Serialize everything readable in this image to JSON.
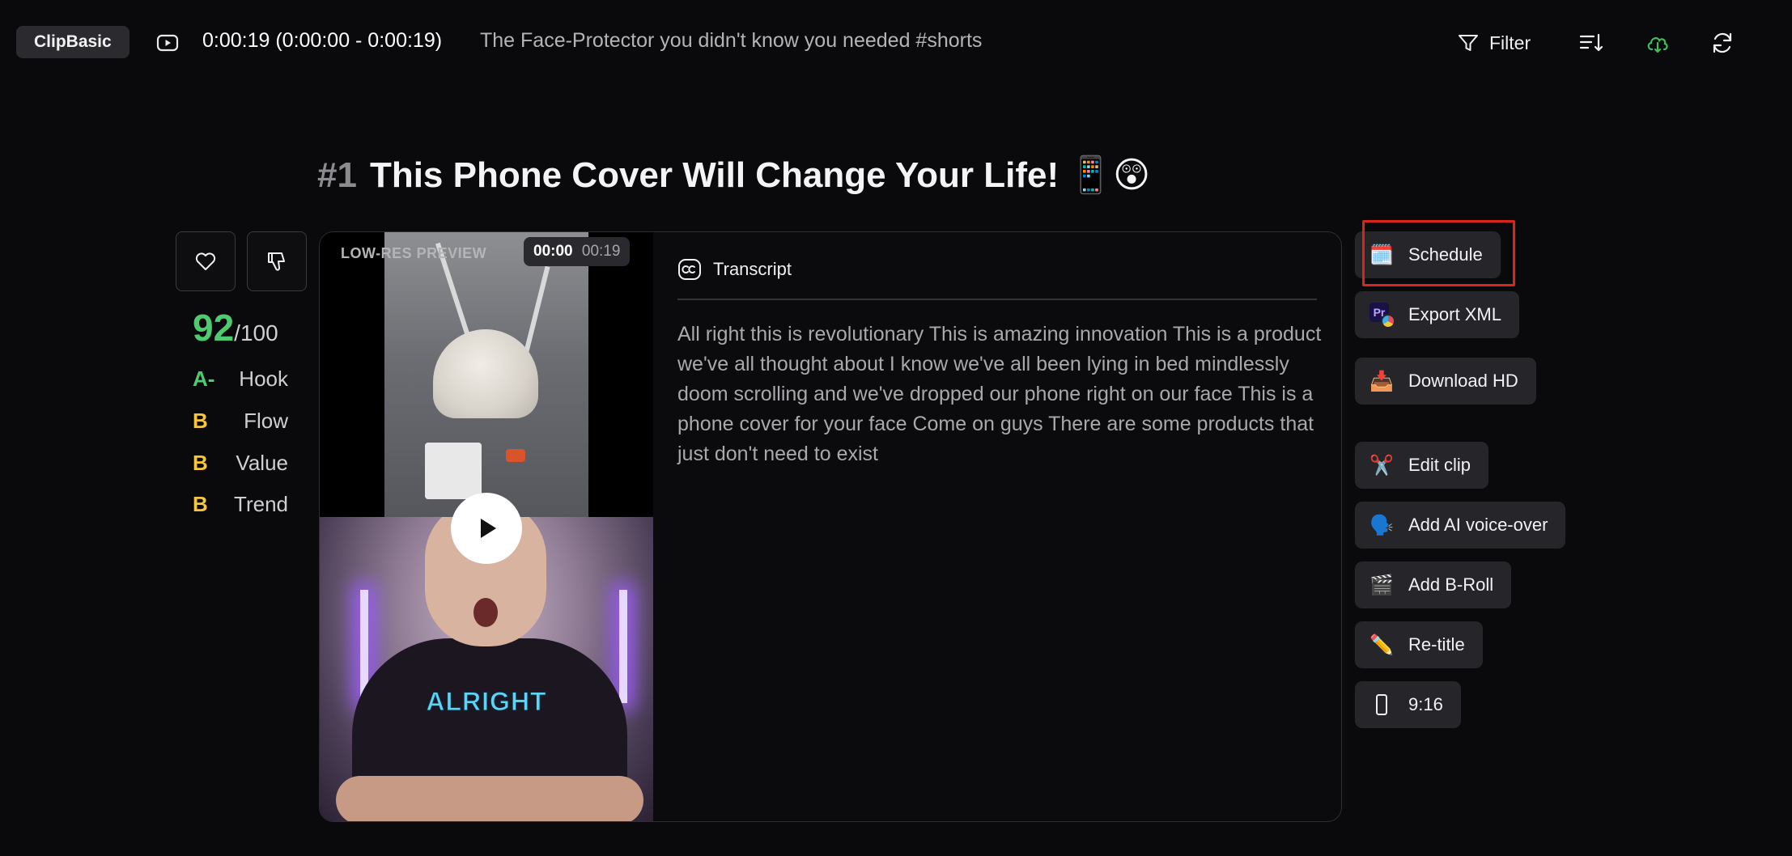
{
  "header": {
    "brand": "ClipBasic",
    "time_range": "0:00:19 (0:00:00 - 0:00:19)",
    "video_title": "The Face-Protector you didn't know you needed #shorts",
    "filter_label": "Filter"
  },
  "clip": {
    "rank": "#1",
    "title": "This Phone Cover Will Change Your Life! 📱😲"
  },
  "score": {
    "value": "92",
    "max": "/100",
    "grades": [
      {
        "grade": "A-",
        "label": "Hook",
        "color": "#4ecb71"
      },
      {
        "grade": "B",
        "label": "Flow",
        "color": "#f5c53b"
      },
      {
        "grade": "B",
        "label": "Value",
        "color": "#f5c53b"
      },
      {
        "grade": "B",
        "label": "Trend",
        "color": "#f5c53b"
      }
    ]
  },
  "video": {
    "preview_label": "LOW-RES PREVIEW",
    "current_time": "00:00",
    "total_time": "00:19",
    "caption": "ALRIGHT"
  },
  "transcript": {
    "heading": "Transcript",
    "text": "All right this is revolutionary This is amazing innovation This is a product we've all thought about I know we've all been lying in bed mindlessly doom scrolling and we've dropped our phone right on our face This is a phone cover for your face Come on guys There are some products that just don't need to exist"
  },
  "actions": {
    "schedule": {
      "label": "Schedule",
      "icon": "🗓️"
    },
    "export_xml": {
      "label": "Export XML",
      "badge": "Pr"
    },
    "download_hd": {
      "label": "Download HD",
      "icon": "📥"
    },
    "edit_clip": {
      "label": "Edit clip",
      "icon": "✂️"
    },
    "voice_over": {
      "label": "Add AI voice-over",
      "icon": "🗣️"
    },
    "broll": {
      "label": "Add B-Roll",
      "icon": "🎬"
    },
    "retitle": {
      "label": "Re-title",
      "icon": "✏️"
    },
    "aspect": {
      "label": "9:16"
    }
  },
  "colors": {
    "accent_green": "#4ecb71",
    "grade_yellow": "#f5c53b",
    "highlight_red": "#d9261c"
  }
}
